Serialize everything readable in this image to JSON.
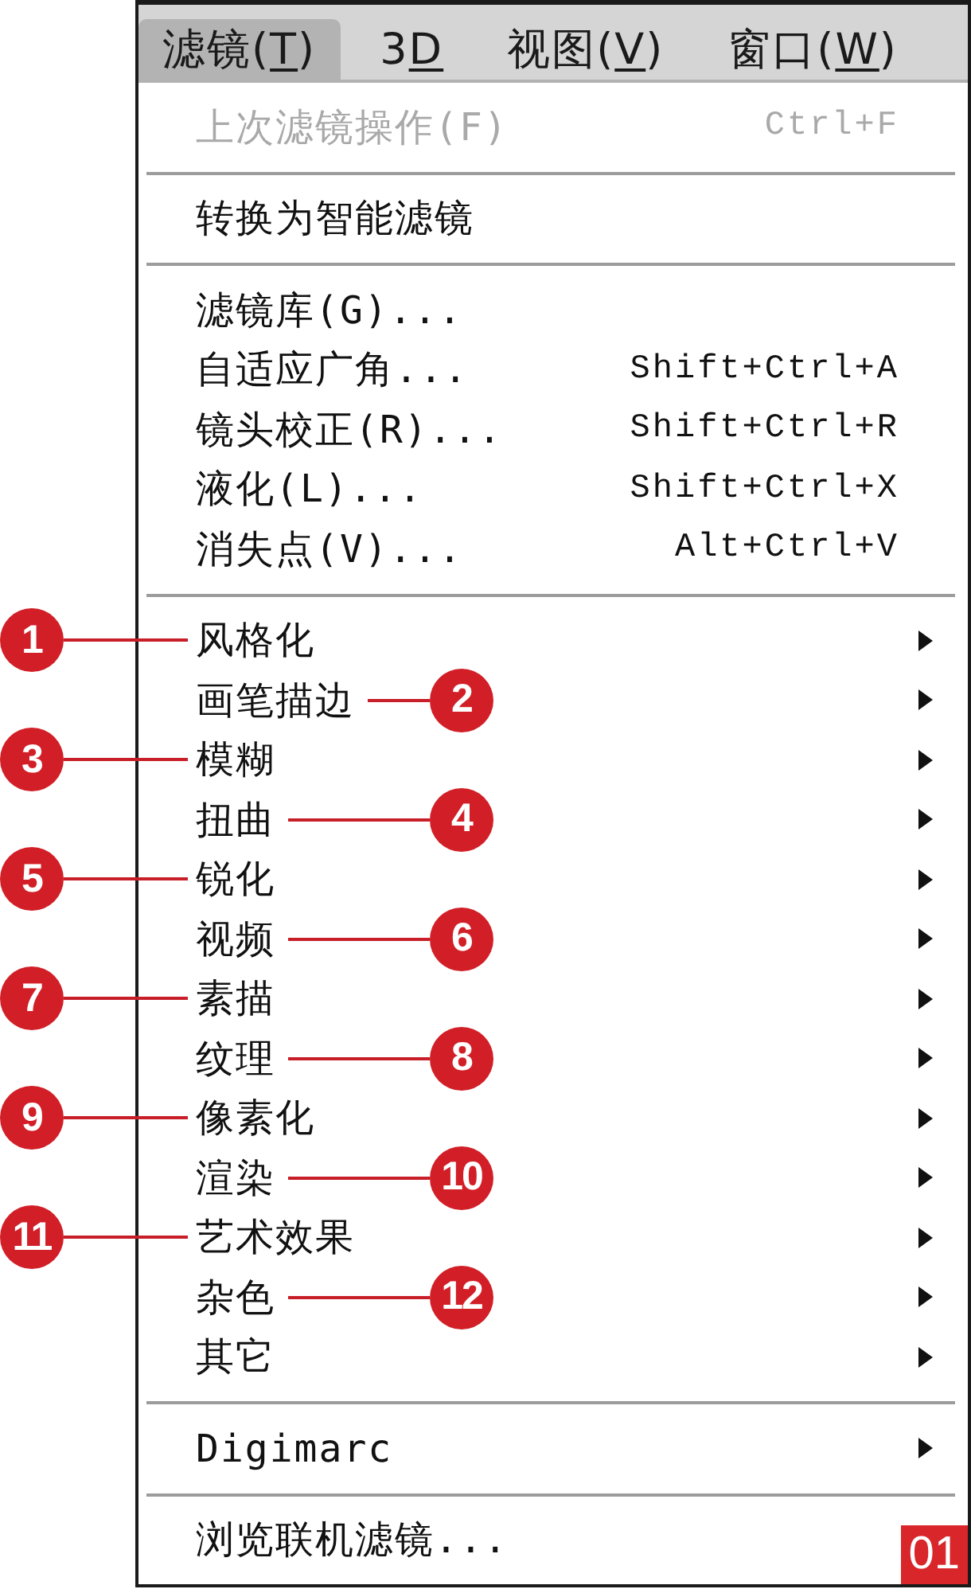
{
  "menu_bar": [
    {
      "prefix": "滤镜(",
      "mnemonic": "T",
      "suffix": ")",
      "selected": true
    },
    {
      "prefix": "3",
      "mnemonic": "D",
      "selected": false
    },
    {
      "prefix": "视图(",
      "mnemonic": "V",
      "suffix": ")",
      "selected": false
    },
    {
      "prefix": "窗口(",
      "mnemonic": "W",
      "suffix": ")",
      "selected": false
    }
  ],
  "menu": {
    "sections": [
      {
        "items": [
          {
            "label": "上次滤镜操作(F)",
            "shortcut": "Ctrl+F",
            "disabled": true,
            "submenu": false
          }
        ]
      },
      {
        "items": [
          {
            "label": "转换为智能滤镜",
            "disabled": false,
            "submenu": false
          }
        ]
      },
      {
        "items": [
          {
            "label": "滤镜库(G)...",
            "disabled": false,
            "submenu": false
          },
          {
            "label": "自适应广角...",
            "shortcut": "Shift+Ctrl+A",
            "disabled": false,
            "submenu": false
          },
          {
            "label": "镜头校正(R)...",
            "shortcut": "Shift+Ctrl+R",
            "disabled": false,
            "submenu": false
          },
          {
            "label": "液化(L)...",
            "shortcut": "Shift+Ctrl+X",
            "disabled": false,
            "submenu": false
          },
          {
            "label": "消失点(V)...",
            "shortcut": "Alt+Ctrl+V",
            "disabled": false,
            "submenu": false
          }
        ]
      },
      {
        "items": [
          {
            "label": "风格化",
            "disabled": false,
            "submenu": true,
            "callout": {
              "number": "1",
              "kind": "left"
            }
          },
          {
            "label": "画笔描边",
            "disabled": false,
            "submenu": true,
            "callout": {
              "number": "2",
              "kind": "right"
            }
          },
          {
            "label": "模糊",
            "disabled": false,
            "submenu": true,
            "callout": {
              "number": "3",
              "kind": "left"
            }
          },
          {
            "label": "扭曲",
            "disabled": false,
            "submenu": true,
            "callout": {
              "number": "4",
              "kind": "right"
            }
          },
          {
            "label": "锐化",
            "disabled": false,
            "submenu": true,
            "callout": {
              "number": "5",
              "kind": "left"
            }
          },
          {
            "label": "视频",
            "disabled": false,
            "submenu": true,
            "callout": {
              "number": "6",
              "kind": "right"
            }
          },
          {
            "label": "素描",
            "disabled": false,
            "submenu": true,
            "callout": {
              "number": "7",
              "kind": "left"
            }
          },
          {
            "label": "纹理",
            "disabled": false,
            "submenu": true,
            "callout": {
              "number": "8",
              "kind": "right"
            }
          },
          {
            "label": "像素化",
            "disabled": false,
            "submenu": true,
            "callout": {
              "number": "9",
              "kind": "left"
            }
          },
          {
            "label": "渲染",
            "disabled": false,
            "submenu": true,
            "callout": {
              "number": "10",
              "kind": "right"
            }
          },
          {
            "label": "艺术效果",
            "disabled": false,
            "submenu": true,
            "callout": {
              "number": "11",
              "kind": "left"
            }
          },
          {
            "label": "杂色",
            "disabled": false,
            "submenu": true,
            "callout": {
              "number": "12",
              "kind": "right"
            }
          },
          {
            "label": "其它",
            "disabled": false,
            "submenu": true
          }
        ]
      },
      {
        "items": [
          {
            "label": "Digimarc",
            "disabled": false,
            "submenu": true
          }
        ]
      },
      {
        "items": [
          {
            "label": "浏览联机滤镜...",
            "disabled": false,
            "submenu": false
          }
        ]
      }
    ]
  },
  "figure_number": "01"
}
